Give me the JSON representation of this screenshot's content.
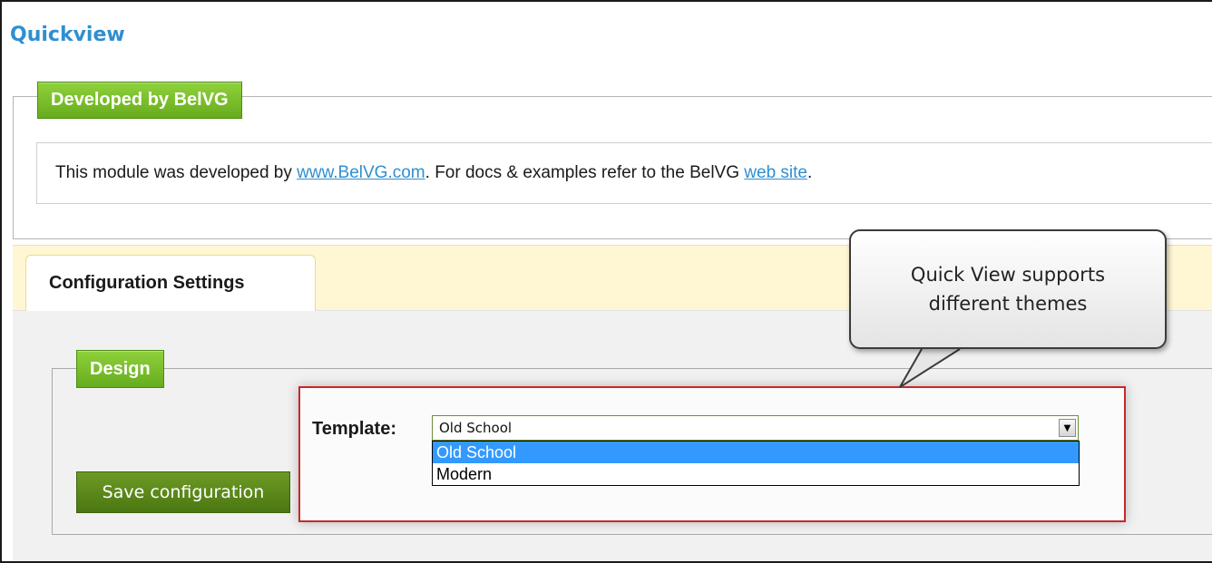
{
  "page": {
    "title": "Quickview"
  },
  "developed": {
    "legend": "Developed by BelVG",
    "text_before": "This module was developed by ",
    "link1": "www.BelVG.com",
    "text_middle": ". For docs & examples refer to the BelVG ",
    "link2": "web site",
    "text_after": "."
  },
  "tabs": {
    "active_label": "Configuration Settings"
  },
  "design": {
    "legend": "Design",
    "template_label": "Template:",
    "selected_value": "Old School",
    "options": [
      "Old School",
      "Modern"
    ],
    "highlighted_option": "Old School"
  },
  "buttons": {
    "save_label": "Save configuration"
  },
  "callout": {
    "line1": "Quick View supports",
    "line2": "different themes"
  },
  "colors": {
    "title_blue": "#2f8fd0",
    "legend_green": "#67ac1d",
    "button_green": "#4b7711",
    "highlight_red": "#c8282a",
    "tab_bar_yellow": "#fff6d4",
    "option_selected_blue": "#3399ff"
  }
}
